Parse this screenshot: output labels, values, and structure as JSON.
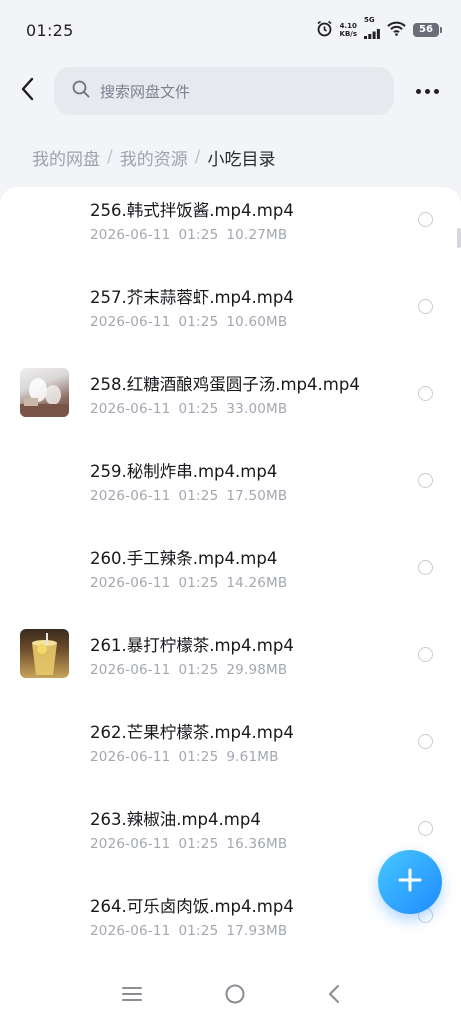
{
  "status_bar": {
    "time": "01:25",
    "net_speed_value": "4.10",
    "net_speed_unit": "KB/s",
    "signal_label": "5G",
    "battery_level": "56"
  },
  "header": {
    "search_placeholder": "搜索网盘文件"
  },
  "breadcrumb": {
    "items": [
      "我的网盘",
      "我的资源",
      "小吃目录"
    ],
    "separator": "/"
  },
  "files": [
    {
      "name": "256.韩式拌饭酱.mp4.mp4",
      "date": "2026-06-11",
      "time": "01:25",
      "size": "10.27MB"
    },
    {
      "name": "257.芥末蒜蓉虾.mp4.mp4",
      "date": "2026-06-11",
      "time": "01:25",
      "size": "10.60MB"
    },
    {
      "name": "258.红糖酒酿鸡蛋圆子汤.mp4.mp4",
      "date": "2026-06-11",
      "time": "01:25",
      "size": "33.00MB"
    },
    {
      "name": "259.秘制炸串.mp4.mp4",
      "date": "2026-06-11",
      "time": "01:25",
      "size": "17.50MB"
    },
    {
      "name": "260.手工辣条.mp4.mp4",
      "date": "2026-06-11",
      "time": "01:25",
      "size": "14.26MB"
    },
    {
      "name": "261.暴打柠檬茶.mp4.mp4",
      "date": "2026-06-11",
      "time": "01:25",
      "size": "29.98MB"
    },
    {
      "name": "262.芒果柠檬茶.mp4.mp4",
      "date": "2026-06-11",
      "time": "01:25",
      "size": "9.61MB"
    },
    {
      "name": "263.辣椒油.mp4.mp4",
      "date": "2026-06-11",
      "time": "01:25",
      "size": "16.36MB"
    },
    {
      "name": "264.可乐卤肉饭.mp4.mp4",
      "date": "2026-06-11",
      "time": "01:25",
      "size": "17.93MB"
    }
  ],
  "colors": {
    "accent": "#1f8bff",
    "background": "#f3f4f8",
    "text_primary": "#18191d",
    "text_secondary": "#a3a7b1"
  }
}
